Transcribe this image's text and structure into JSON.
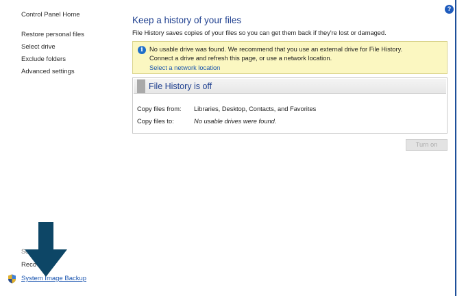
{
  "nav": {
    "home": "Control Panel Home",
    "items": [
      {
        "label": "Restore personal files"
      },
      {
        "label": "Select drive"
      },
      {
        "label": "Exclude folders"
      },
      {
        "label": "Advanced settings"
      }
    ],
    "see_also_partial": "See",
    "recovery_partial": "Recove",
    "system_image_backup": "System Image Backup"
  },
  "main": {
    "title": "Keep a history of your files",
    "description": "File History saves copies of your files so you can get them back if they're lost or damaged.",
    "notice": {
      "line1": "No usable drive was found. We recommend that you use an external drive for File History.",
      "line2": "Connect a drive and refresh this page, or use a network location.",
      "link": "Select a network location"
    },
    "status": {
      "title": "File History is off",
      "rows": [
        {
          "label": "Copy files from:",
          "value": "Libraries, Desktop, Contacts, and Favorites"
        },
        {
          "label": "Copy files to:",
          "value": "No usable drives were found."
        }
      ]
    },
    "turn_on_label": "Turn on"
  },
  "help_icon": "?",
  "info_icon": "i",
  "colors": {
    "title_blue": "#1e3f8f",
    "link_blue": "#1a55b0",
    "notice_bg": "#fbf7c1",
    "arrow": "#0d4666"
  }
}
